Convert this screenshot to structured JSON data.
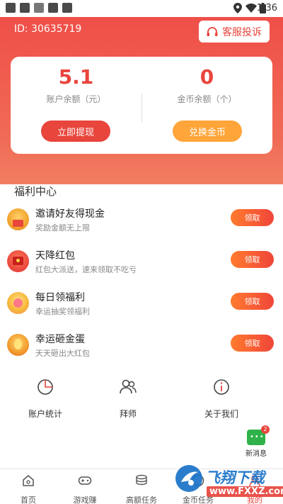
{
  "status_bar": {
    "time": "1:36"
  },
  "header": {
    "user_id": "ID: 30635719",
    "service_label": "客服投诉"
  },
  "balances": {
    "account": {
      "value": "5.1",
      "label": "账户余额（元）",
      "button": "立即提现"
    },
    "coins": {
      "value": "0",
      "label": "金币余额（个）",
      "button": "兑换金币"
    }
  },
  "welfare": {
    "title": "福利中心",
    "items": [
      {
        "title": "邀请好友得现金",
        "subtitle": "奖励金额无上限",
        "button": "领取"
      },
      {
        "title": "天降红包",
        "subtitle": "红包大派送，速来领取不吃亏",
        "button": "领取"
      },
      {
        "title": "每日领福利",
        "subtitle": "幸运抽奖领福利",
        "button": "领取"
      },
      {
        "title": "幸运砸金蛋",
        "subtitle": "天天砸出大红包",
        "button": "领取"
      }
    ]
  },
  "shortcuts": [
    {
      "label": "账户统计",
      "icon": "pie-chart-icon"
    },
    {
      "label": "拜师",
      "icon": "people-icon"
    },
    {
      "label": "关于我们",
      "icon": "info-icon"
    }
  ],
  "message": {
    "label": "新消息",
    "badge": "2"
  },
  "tabs": [
    {
      "label": "首页",
      "icon": "home-icon"
    },
    {
      "label": "游戏赚",
      "icon": "gamepad-icon"
    },
    {
      "label": "高额任务",
      "icon": "coins-stack-icon"
    },
    {
      "label": "金币任务",
      "icon": "coin-icon"
    },
    {
      "label": "我的",
      "icon": "user-icon"
    }
  ],
  "watermark": {
    "text": "飞翔下载",
    "url": "www.FXXZ.com"
  },
  "colors": {
    "primary": "#e8453c",
    "orange": "#ffa53a",
    "green": "#2fb24a"
  }
}
